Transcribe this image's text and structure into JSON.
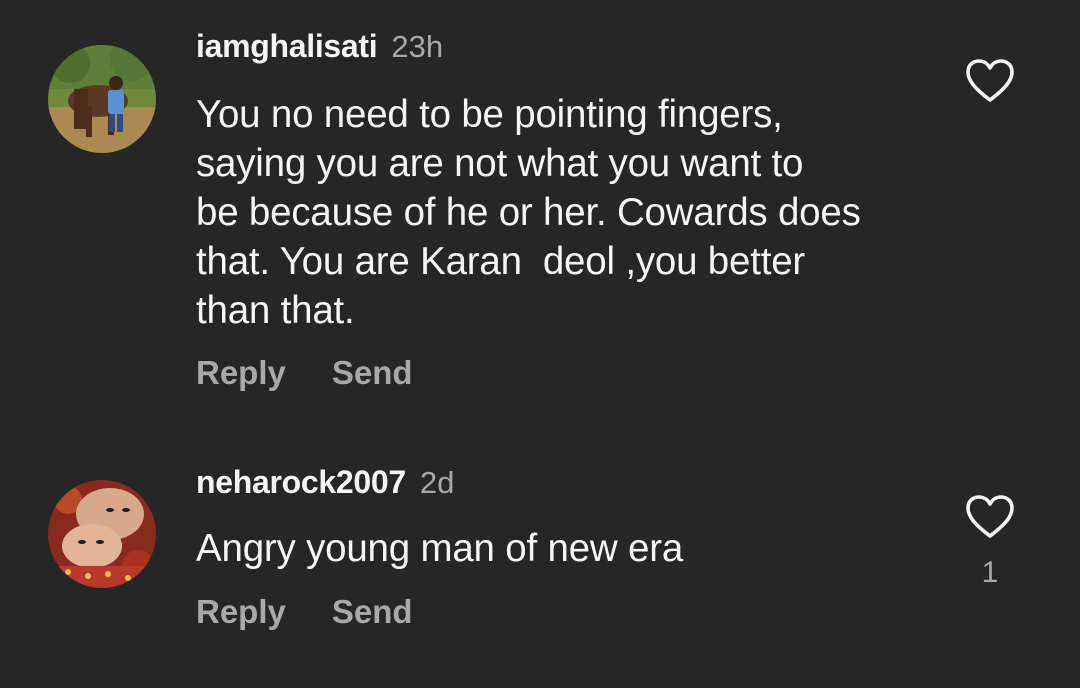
{
  "comments": [
    {
      "username": "iamghalisati",
      "time": "23h",
      "text": "You no need to be pointing fingers,\nsaying you are not what you want to\nbe because of he or her. Cowards does\nthat. You are Karan  deol ,you better\nthan that.",
      "reply_label": "Reply",
      "send_label": "Send",
      "like_icon": "heart-outline-icon",
      "like_count": ""
    },
    {
      "username": "neharock2007",
      "time": "2d",
      "text": "Angry young man of new era",
      "reply_label": "Reply",
      "send_label": "Send",
      "like_icon": "heart-outline-icon",
      "like_count": "1"
    }
  ],
  "colors": {
    "background": "#262626",
    "primary_text": "#f5f5f5",
    "secondary_text": "#a8a8a8"
  }
}
